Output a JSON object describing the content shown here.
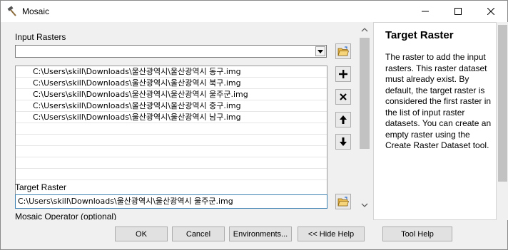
{
  "window": {
    "title": "Mosaic",
    "icon": "hammer-icon"
  },
  "input_rasters": {
    "label": "Input Rasters",
    "dropdown_value": "",
    "items": [
      "C:\\Users\\skill\\Downloads\\울산광역시\\울산광역시 동구.img",
      "C:\\Users\\skill\\Downloads\\울산광역시\\울산광역시 북구.img",
      "C:\\Users\\skill\\Downloads\\울산광역시\\울산광역시 울주군.img",
      "C:\\Users\\skill\\Downloads\\울산광역시\\울산광역시 중구.img",
      "C:\\Users\\skill\\Downloads\\울산광역시\\울산광역시 남구.img"
    ]
  },
  "target_raster": {
    "label": "Target Raster",
    "value": "C:\\Users\\skill\\Downloads\\울산광역시\\울산광역시 울주군.img"
  },
  "mosaic_operator": {
    "label": "Mosaic Operator (optional)"
  },
  "help": {
    "title": "Target Raster",
    "body": "The raster to add the input rasters. This raster dataset must already exist. By default, the target raster is considered the first raster in the list of input raster datasets. You can create an empty raster using the Create Raster Dataset tool."
  },
  "buttons": {
    "ok": "OK",
    "cancel": "Cancel",
    "environments": "Environments...",
    "hide_help": "<< Hide Help",
    "tool_help": "Tool Help"
  }
}
